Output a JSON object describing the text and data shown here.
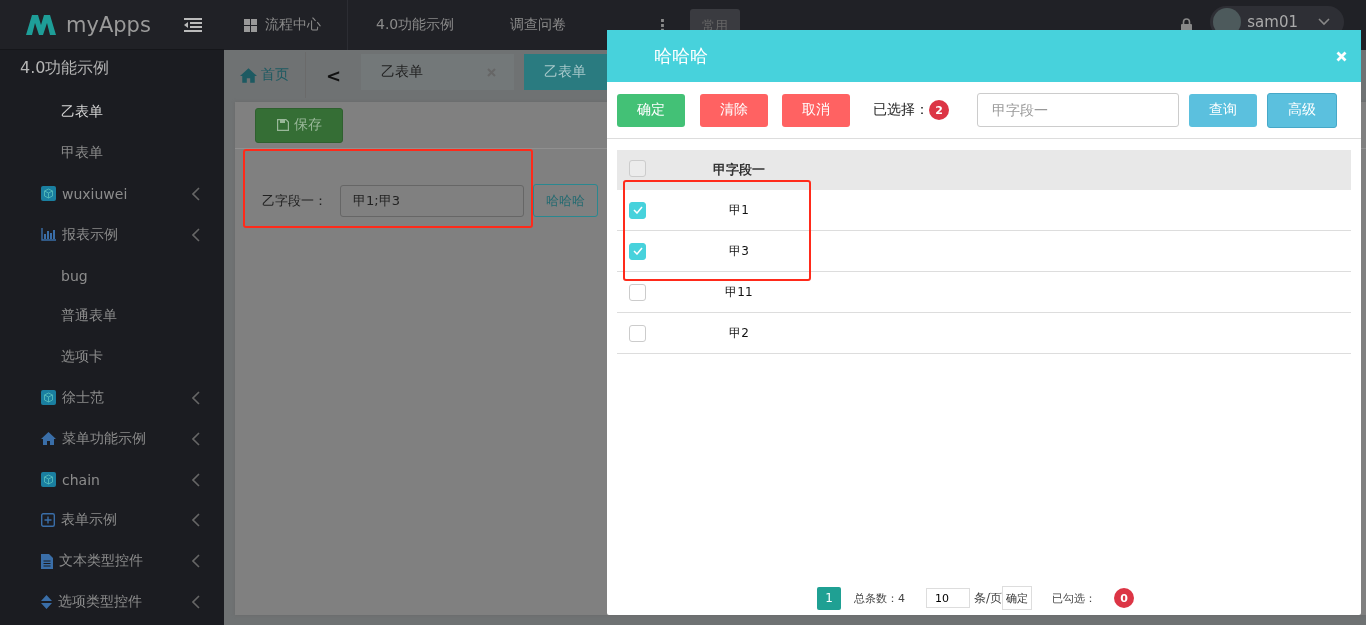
{
  "brand": {
    "name": "myApps"
  },
  "top_nav": [
    {
      "kind": "grid",
      "label": "流程中心"
    },
    {
      "kind": "plain",
      "label": "4.0功能示例"
    },
    {
      "kind": "plain",
      "label": "调查问卷"
    },
    {
      "kind": "more",
      "label": "⋮"
    },
    {
      "kind": "chip",
      "label": "常用"
    }
  ],
  "user": {
    "name": "sam01"
  },
  "sidebar": {
    "title": "4.0功能示例",
    "items": [
      {
        "kind": "leaf",
        "label": "乙表单",
        "selected": true
      },
      {
        "kind": "leaf",
        "label": "甲表单",
        "selected": false
      },
      {
        "kind": "cube",
        "label": "wuxiuwei",
        "selected": false
      },
      {
        "kind": "chart",
        "label": "报表示例",
        "selected": false
      },
      {
        "kind": "leaf",
        "label": "bug",
        "selected": false
      },
      {
        "kind": "leaf",
        "label": "普通表单",
        "selected": false
      },
      {
        "kind": "leaf",
        "label": "选项卡",
        "selected": false
      },
      {
        "kind": "cube",
        "label": "徐士范",
        "selected": false
      },
      {
        "kind": "home",
        "label": "菜单功能示例",
        "selected": false
      },
      {
        "kind": "cube",
        "label": "chain",
        "selected": false
      },
      {
        "kind": "plus",
        "label": "表单示例",
        "selected": false
      },
      {
        "kind": "file",
        "label": "文本类型控件",
        "selected": false
      },
      {
        "kind": "sort",
        "label": "选项类型控件",
        "selected": false
      }
    ]
  },
  "home_tab": {
    "label": "首页"
  },
  "scroll_left": "<",
  "tabs": [
    {
      "label": "乙表单",
      "closable": true,
      "selected": false
    },
    {
      "label": "乙表单",
      "closable": false,
      "selected": true
    }
  ],
  "form": {
    "save_button": "保存",
    "field_label": "乙字段一：",
    "field_value": "甲1;甲3",
    "picker_button": "哈哈哈"
  },
  "dialog": {
    "title": "哈哈哈",
    "buttons": [
      {
        "kind": "ok",
        "label": "确定"
      },
      {
        "kind": "danger",
        "label": "清除"
      },
      {
        "kind": "danger",
        "label": "取消"
      }
    ],
    "selected_label": "已选择：",
    "selected_count": "2",
    "search": {
      "placeholder": "甲字段一"
    },
    "search_buttons": [
      {
        "kind": "info",
        "label": "查询"
      },
      {
        "kind": "info-alt",
        "label": "高级"
      }
    ],
    "table": {
      "columns": [
        "甲字段一"
      ],
      "header_checked": false,
      "rows": [
        {
          "cell": "甲1",
          "checked": true
        },
        {
          "cell": "甲3",
          "checked": true
        },
        {
          "cell": "甲11",
          "checked": false
        },
        {
          "cell": "甲2",
          "checked": false
        }
      ]
    },
    "pagination": {
      "page": "1",
      "total": "总条数：4",
      "page_size": "10",
      "per_page": "条/页",
      "go": "确定",
      "checked_label": "已勾选：",
      "checked_count": "0"
    }
  },
  "annotations": [
    {
      "kind": "frame"
    },
    {
      "kind": "frame"
    }
  ]
}
